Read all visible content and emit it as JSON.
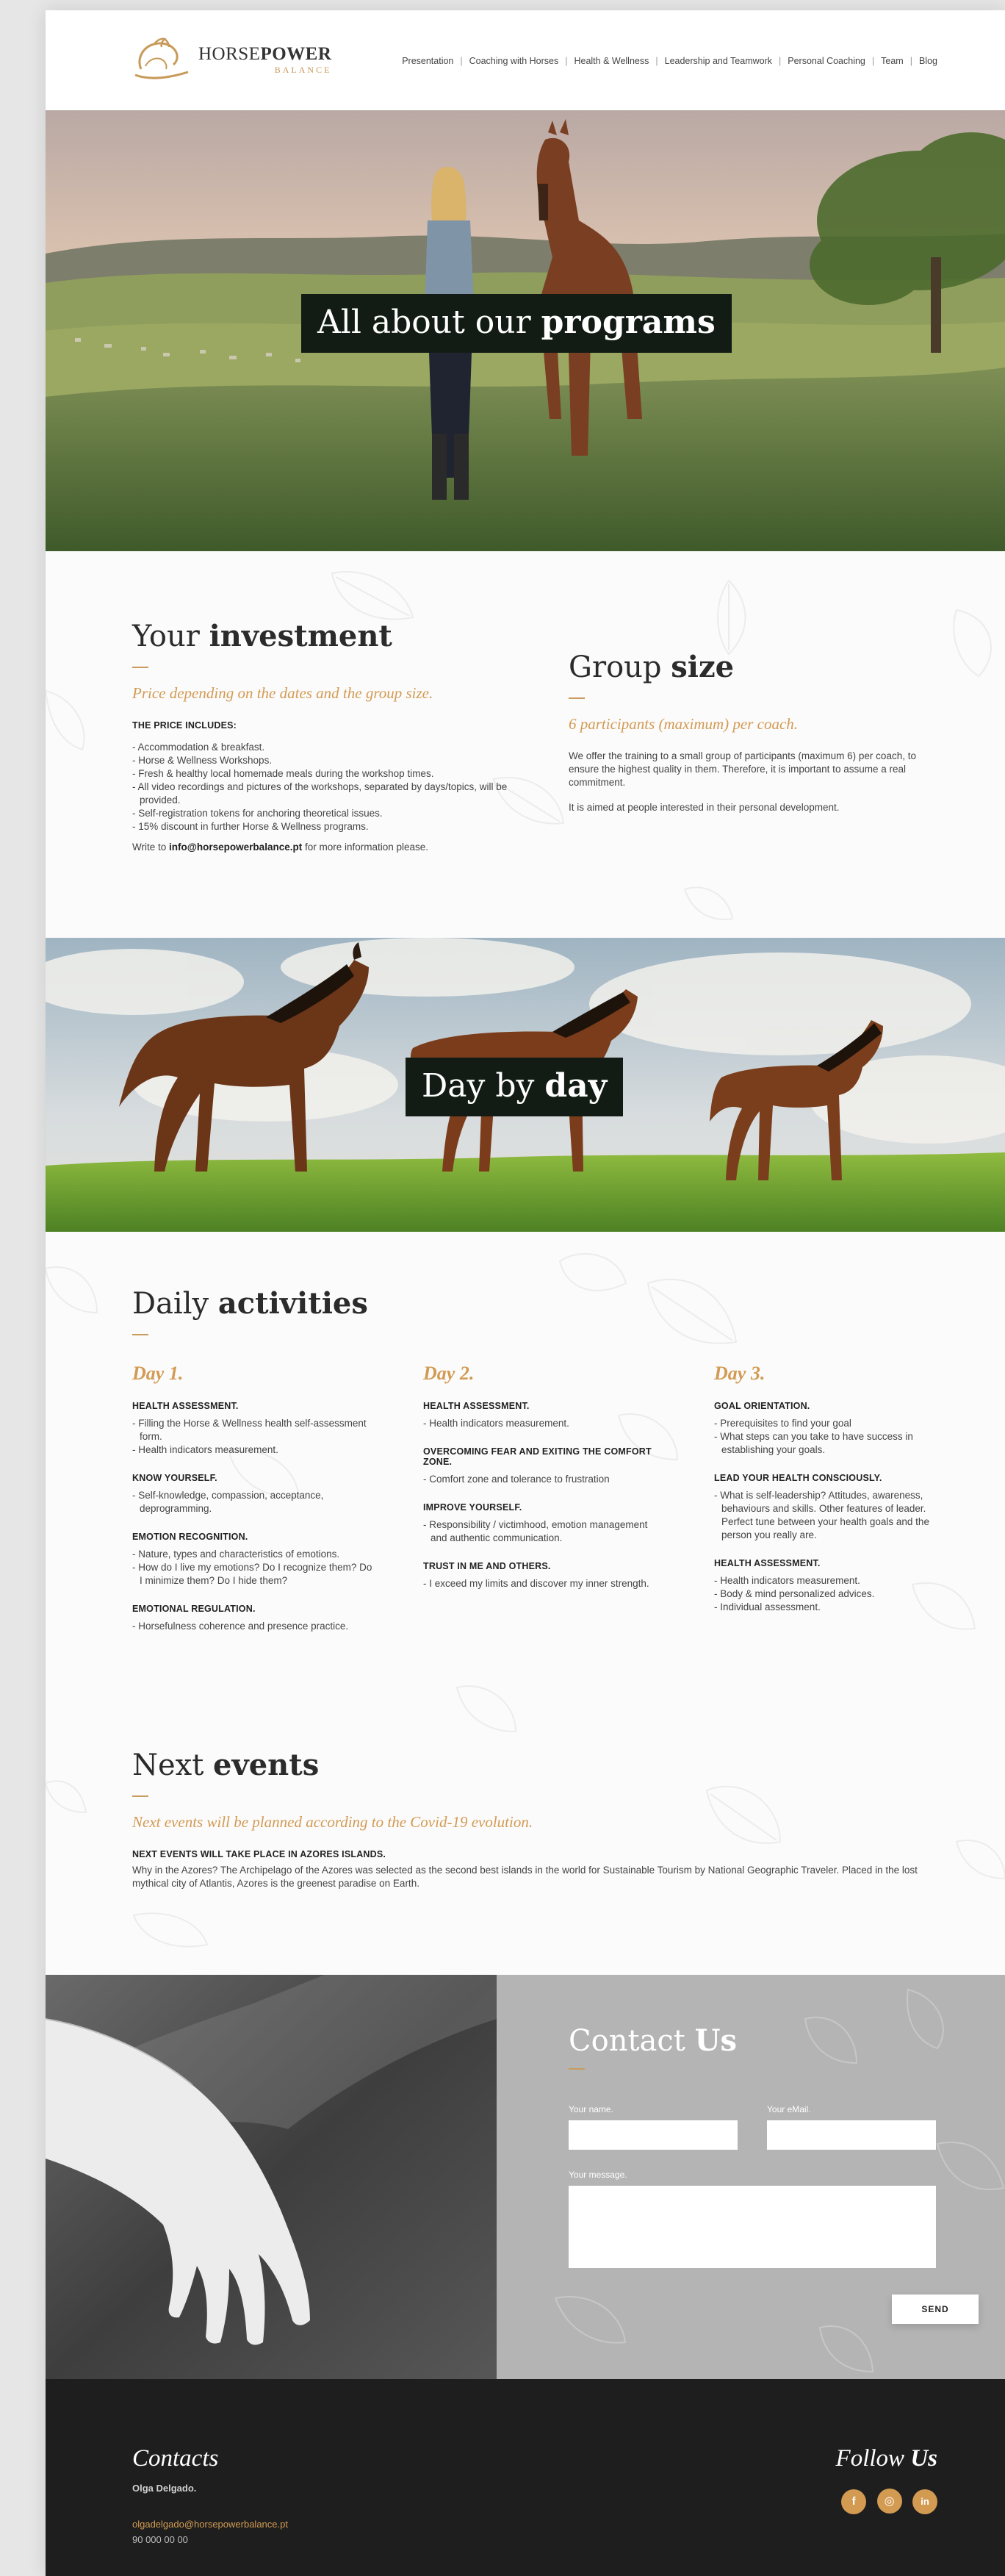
{
  "brand": {
    "name_part1": "HORSE",
    "name_part2": "POWER",
    "tagline": "BALANCE"
  },
  "nav": [
    "Presentation",
    "Coaching with Horses",
    "Health & Wellness",
    "Leadership and Teamwork",
    "Personal Coaching",
    "Team",
    "Blog"
  ],
  "hero": {
    "title_light": "All about our ",
    "title_bold": "programs"
  },
  "investment": {
    "title_light": "Your ",
    "title_bold": "investment",
    "lead": "Price depending on the dates and the group size.",
    "caption": "THE PRICE INCLUDES:",
    "items": [
      "Accommodation & breakfast.",
      "Horse & Wellness Workshops.",
      "Fresh & healthy local homemade meals during the workshop times.",
      "All video recordings and pictures of the workshops, separated by days/topics, will be provided.",
      "Self-registration tokens for anchoring theoretical issues.",
      "15% discount in further Horse & Wellness programs."
    ],
    "write_prefix": "Write to ",
    "email": "info@horsepowerbalance.pt",
    "write_suffix": " for more information please."
  },
  "group": {
    "title_light": "Group ",
    "title_bold": "size",
    "lead": "6 participants (maximum) per coach.",
    "p1": "We offer the training to a small group of participants (maximum 6) per coach, to ensure the highest quality in them. Therefore, it is important to assume a real commitment.",
    "p2": "It is aimed at people interested in their personal development."
  },
  "day_banner": {
    "title_light": "Day by ",
    "title_bold": "day"
  },
  "daily": {
    "title_light": "Daily ",
    "title_bold": "activities",
    "days": [
      {
        "title": "Day 1.",
        "blocks": [
          {
            "caption": "HEALTH ASSESSMENT.",
            "items": [
              "Filling the Horse & Wellness health self-assessment form.",
              "Health indicators measurement."
            ]
          },
          {
            "caption": "KNOW YOURSELF.",
            "items": [
              "Self-knowledge, compassion, acceptance, deprogramming."
            ]
          },
          {
            "caption": "EMOTION RECOGNITION.",
            "items": [
              "Nature, types and characteristics of emotions.",
              "How do I live my emotions? Do I recognize them? Do I minimize them? Do I hide them?"
            ]
          },
          {
            "caption": "EMOTIONAL REGULATION.",
            "items": [
              "Horsefulness coherence and presence practice."
            ]
          }
        ]
      },
      {
        "title": "Day 2.",
        "blocks": [
          {
            "caption": "HEALTH ASSESSMENT.",
            "items": [
              "Health indicators measurement."
            ]
          },
          {
            "caption": "OVERCOMING FEAR AND EXITING THE COMFORT ZONE.",
            "items": [
              "Comfort zone and tolerance to frustration"
            ]
          },
          {
            "caption": "IMPROVE YOURSELF.",
            "items": [
              "Responsibility / victimhood, emotion management and authentic communication."
            ]
          },
          {
            "caption": "TRUST IN ME AND OTHERS.",
            "items": [
              "I exceed my limits and discover my inner strength."
            ]
          }
        ]
      },
      {
        "title": "Day 3.",
        "blocks": [
          {
            "caption": "GOAL ORIENTATION.",
            "items": [
              "Prerequisites to find your goal",
              "What steps can you take to have success in establishing your goals."
            ]
          },
          {
            "caption": "LEAD YOUR HEALTH CONSCIOUSLY.",
            "items": [
              "What is self-leadership? Attitudes, awareness, behaviours and skills. Other features of leader. Perfect tune between your health goals and the  person you really are."
            ]
          },
          {
            "caption": "HEALTH ASSESSMENT.",
            "items": [
              "Health indicators measurement.",
              "Body & mind personalized advices.",
              "Individual assessment."
            ]
          }
        ]
      }
    ]
  },
  "events": {
    "title_light": "Next ",
    "title_bold": "events",
    "lead": "Next events will be planned according to the Covid-19 evolution.",
    "caption": "NEXT EVENTS WILL TAKE PLACE IN AZORES ISLANDS.",
    "text": "Why in the Azores? The Archipelago of the Azores was selected as the second best islands in the world for Sustainable Tourism by National Geographic Traveler. Placed in the lost mythical city of Atlantis, Azores is the greenest paradise on Earth."
  },
  "contact": {
    "title_light": "Contact ",
    "title_bold": "Us",
    "name_label": "Your name.",
    "email_label": "Your eMail.",
    "message_label": "Your message.",
    "send_label": "SEND"
  },
  "footer": {
    "contacts_title": "Contacts",
    "person": "Olga Delgado.",
    "email": "olgadelgado@horsepowerbalance.pt",
    "phone": "90 000 00 00",
    "follow_light": "Follow ",
    "follow_bold": "Us",
    "social": [
      {
        "name": "facebook-icon",
        "glyph": "f"
      },
      {
        "name": "instagram-icon",
        "glyph": "◎"
      },
      {
        "name": "linkedin-icon",
        "glyph": "in"
      }
    ]
  },
  "colors": {
    "accent": "#d29a52",
    "banner_label_bg": "#121c14",
    "contact_bg": "#b4b4b4",
    "footer_bg": "#1e1e1e"
  }
}
